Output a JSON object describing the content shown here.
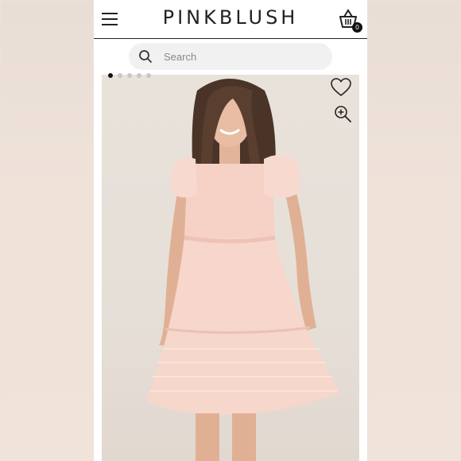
{
  "header": {
    "brand": "PINKBLUSH",
    "menu_icon": "hamburger-menu-icon",
    "cart_icon": "shopping-basket-icon",
    "cart_count": "0"
  },
  "search": {
    "placeholder": "Search",
    "icon": "search-icon"
  },
  "gallery": {
    "image_count": 5,
    "active_index": 0,
    "favorite_icon": "heart-outline-icon",
    "zoom_icon": "zoom-in-icon"
  },
  "colors": {
    "dress": "#f6d2c6",
    "active_dot": "#111111",
    "inactive_dot": "#c7c7c7"
  }
}
